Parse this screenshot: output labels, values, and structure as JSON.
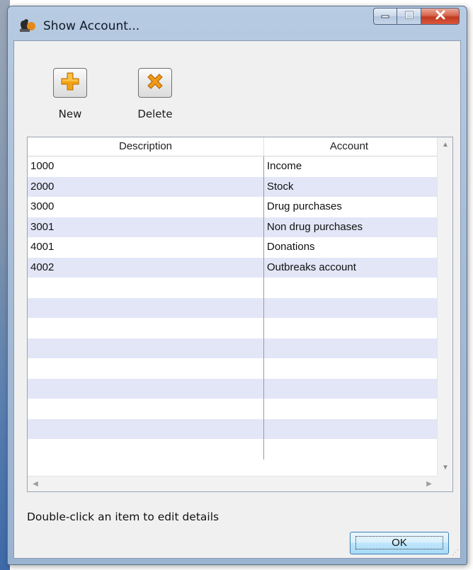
{
  "window": {
    "title": "Show Account...",
    "icons": {
      "app": "app-icon",
      "minimize": "minimize-icon",
      "maximize": "maximize-icon",
      "close": "close-icon"
    }
  },
  "toolbar": {
    "new_label": "New",
    "delete_label": "Delete",
    "icons": {
      "new": "plus-icon",
      "delete": "x-icon"
    },
    "colors": {
      "new_icon": "#f2a313",
      "delete_icon": "#ef9a1a"
    }
  },
  "table": {
    "columns": [
      "Description",
      "Account"
    ],
    "rows": [
      {
        "description": "1000",
        "account": "Income"
      },
      {
        "description": "2000",
        "account": "Stock"
      },
      {
        "description": "3000",
        "account": "Drug purchases"
      },
      {
        "description": "3001",
        "account": "Non drug purchases"
      },
      {
        "description": "4001",
        "account": "Donations"
      },
      {
        "description": "4002",
        "account": "Outbreaks account"
      }
    ],
    "alt_row_color": "#e3e6f7"
  },
  "footer": {
    "hint": "Double-click an item to edit details",
    "ok_label": "OK"
  }
}
